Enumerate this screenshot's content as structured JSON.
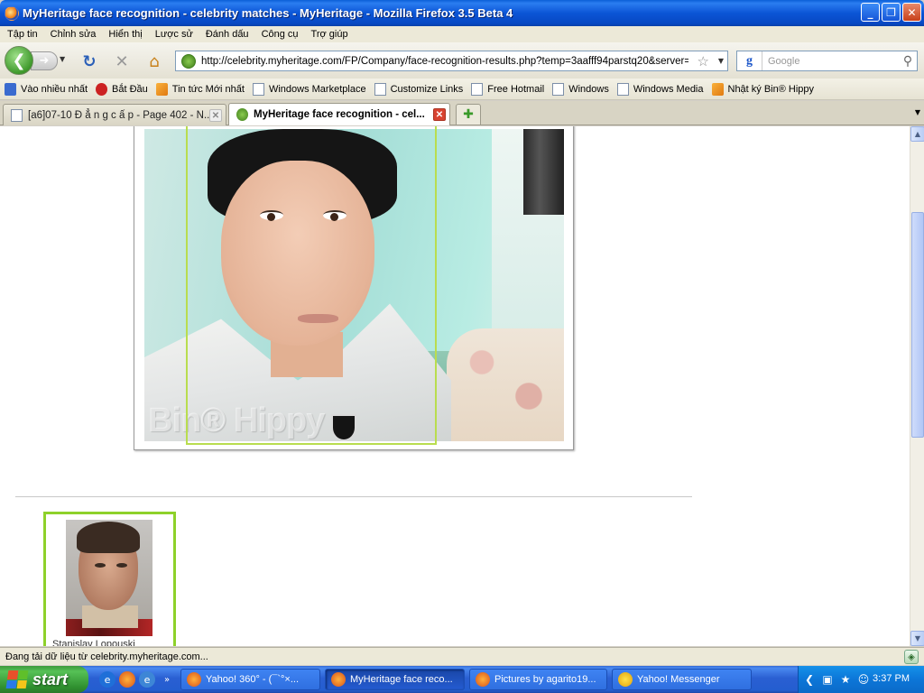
{
  "window": {
    "title": "MyHeritage face recognition - celebrity matches - MyHeritage - Mozilla Firefox 3.5 Beta 4",
    "buttons": {
      "minimize": "_",
      "maximize": "❐",
      "close": "✕"
    }
  },
  "menubar": {
    "items": [
      "Tập tin",
      "Chỉnh sửa",
      "Hiển thị",
      "Lược sử",
      "Đánh dấu",
      "Công cụ",
      "Trợ giúp"
    ]
  },
  "navbar": {
    "url": "http://celebrity.myheritage.com/FP/Company/face-recognition-results.php?temp=3aafff94parstq20&server=Se",
    "search_placeholder": "Google"
  },
  "bookmarks": [
    {
      "label": "Vào nhiều nhất",
      "icon": "magnifier-icon"
    },
    {
      "label": "Bắt Đầu",
      "icon": "firefox-icon"
    },
    {
      "label": "Tin tức Mới nhất",
      "icon": "rss-icon"
    },
    {
      "label": "Windows Marketplace",
      "icon": "page-icon"
    },
    {
      "label": "Customize Links",
      "icon": "page-icon"
    },
    {
      "label": "Free Hotmail",
      "icon": "page-icon"
    },
    {
      "label": "Windows",
      "icon": "page-icon"
    },
    {
      "label": "Windows Media",
      "icon": "page-icon"
    },
    {
      "label": "Nhật ký Bin® Hippy",
      "icon": "rss-icon"
    }
  ],
  "tabs": [
    {
      "label": "[a6]07-10 Đ ẳ n g c ấ p - Page 402 - N...",
      "active": false
    },
    {
      "label": "MyHeritage face recognition - cel...",
      "active": true
    }
  ],
  "content": {
    "photo_watermark": "Bin® Hippy",
    "match": {
      "name": "Stanislav Lopouski"
    }
  },
  "status": {
    "text": "Đang tải dữ liệu từ celebrity.myheritage.com..."
  },
  "taskbar": {
    "start_label": "start",
    "tasks": [
      {
        "label": "Yahoo! 360° - (¯`°×...",
        "active": false
      },
      {
        "label": "MyHeritage face reco...",
        "active": true
      },
      {
        "label": "Pictures by agarito19...",
        "active": false
      },
      {
        "label": "Yahoo! Messenger",
        "active": false
      }
    ],
    "clock": "3:37 PM"
  },
  "colors": {
    "face_box": "#b9dd4f",
    "match_border": "#8ed12a",
    "titlebar": "#0b55d6",
    "taskbar": "#245ed0",
    "start": "#3c9a3c"
  }
}
